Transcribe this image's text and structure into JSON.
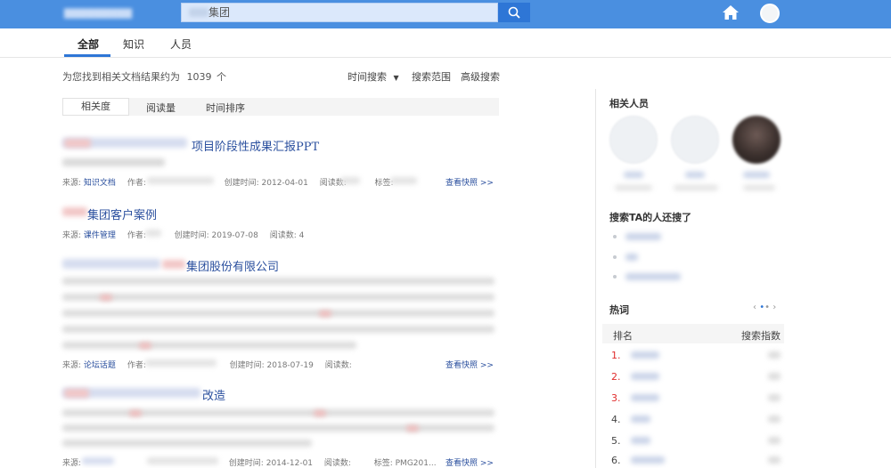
{
  "header": {
    "search_value": "集团",
    "icons": {
      "search": "search-icon",
      "home": "home-icon",
      "user": "user-avatar"
    }
  },
  "tabs": [
    {
      "label": "全部",
      "active": true
    },
    {
      "label": "知识",
      "active": false
    },
    {
      "label": "人员",
      "active": false
    }
  ],
  "results_summary": {
    "prefix": "为您找到相关文档结果约为",
    "count": "1039",
    "suffix": "个"
  },
  "tools": {
    "time_search": "时间搜索",
    "scope": "搜索范围",
    "advanced": "高级搜索"
  },
  "sort_options": [
    {
      "label": "相关度",
      "active": true
    },
    {
      "label": "阅读量",
      "active": false
    },
    {
      "label": "时间排序",
      "active": false
    }
  ],
  "results": [
    {
      "title_suffix": "项目阶段性成果汇报PPT",
      "source_label": "来源:",
      "source": "知识文档",
      "author_label": "作者:",
      "created_label": "创建时间:",
      "created": "2012-04-01",
      "reads_label": "阅读数:",
      "tags_label": "标签:",
      "snapshot": "查看快照 >>"
    },
    {
      "title_suffix": "集团客户案例",
      "source_label": "来源:",
      "source": "课件管理",
      "author_label": "作者:",
      "created_label": "创建时间:",
      "created": "2019-07-08",
      "reads_label": "阅读数:",
      "reads": "4"
    },
    {
      "title_suffix": "集团股份有限公司",
      "source_label": "来源:",
      "source": "论坛话题",
      "author_label": "作者:",
      "created_label": "创建时间:",
      "created": "2018-07-19",
      "reads_label": "阅读数:",
      "snapshot": "查看快照 >>"
    },
    {
      "title_suffix": "改造",
      "source_label": "来源:",
      "created_label": "创建时间:",
      "created": "2014-12-01",
      "reads_label": "阅读数:",
      "tags_label": "标签:",
      "tags": "PMG201...",
      "snapshot": "查看快照 >>"
    }
  ],
  "sidebar": {
    "people_title": "相关人员",
    "also_searched_title": "搜索TA的人还搜了",
    "hotwords_title": "热词",
    "hot_header_rank": "排名",
    "hot_header_index": "搜索指数",
    "hot_ranks": [
      "1.",
      "2.",
      "3.",
      "4.",
      "5.",
      "6."
    ]
  },
  "colors": {
    "header": "#4a8fe0",
    "accent": "#2e76d6",
    "link": "#2a4f9e",
    "hot": "#e02b2b"
  }
}
